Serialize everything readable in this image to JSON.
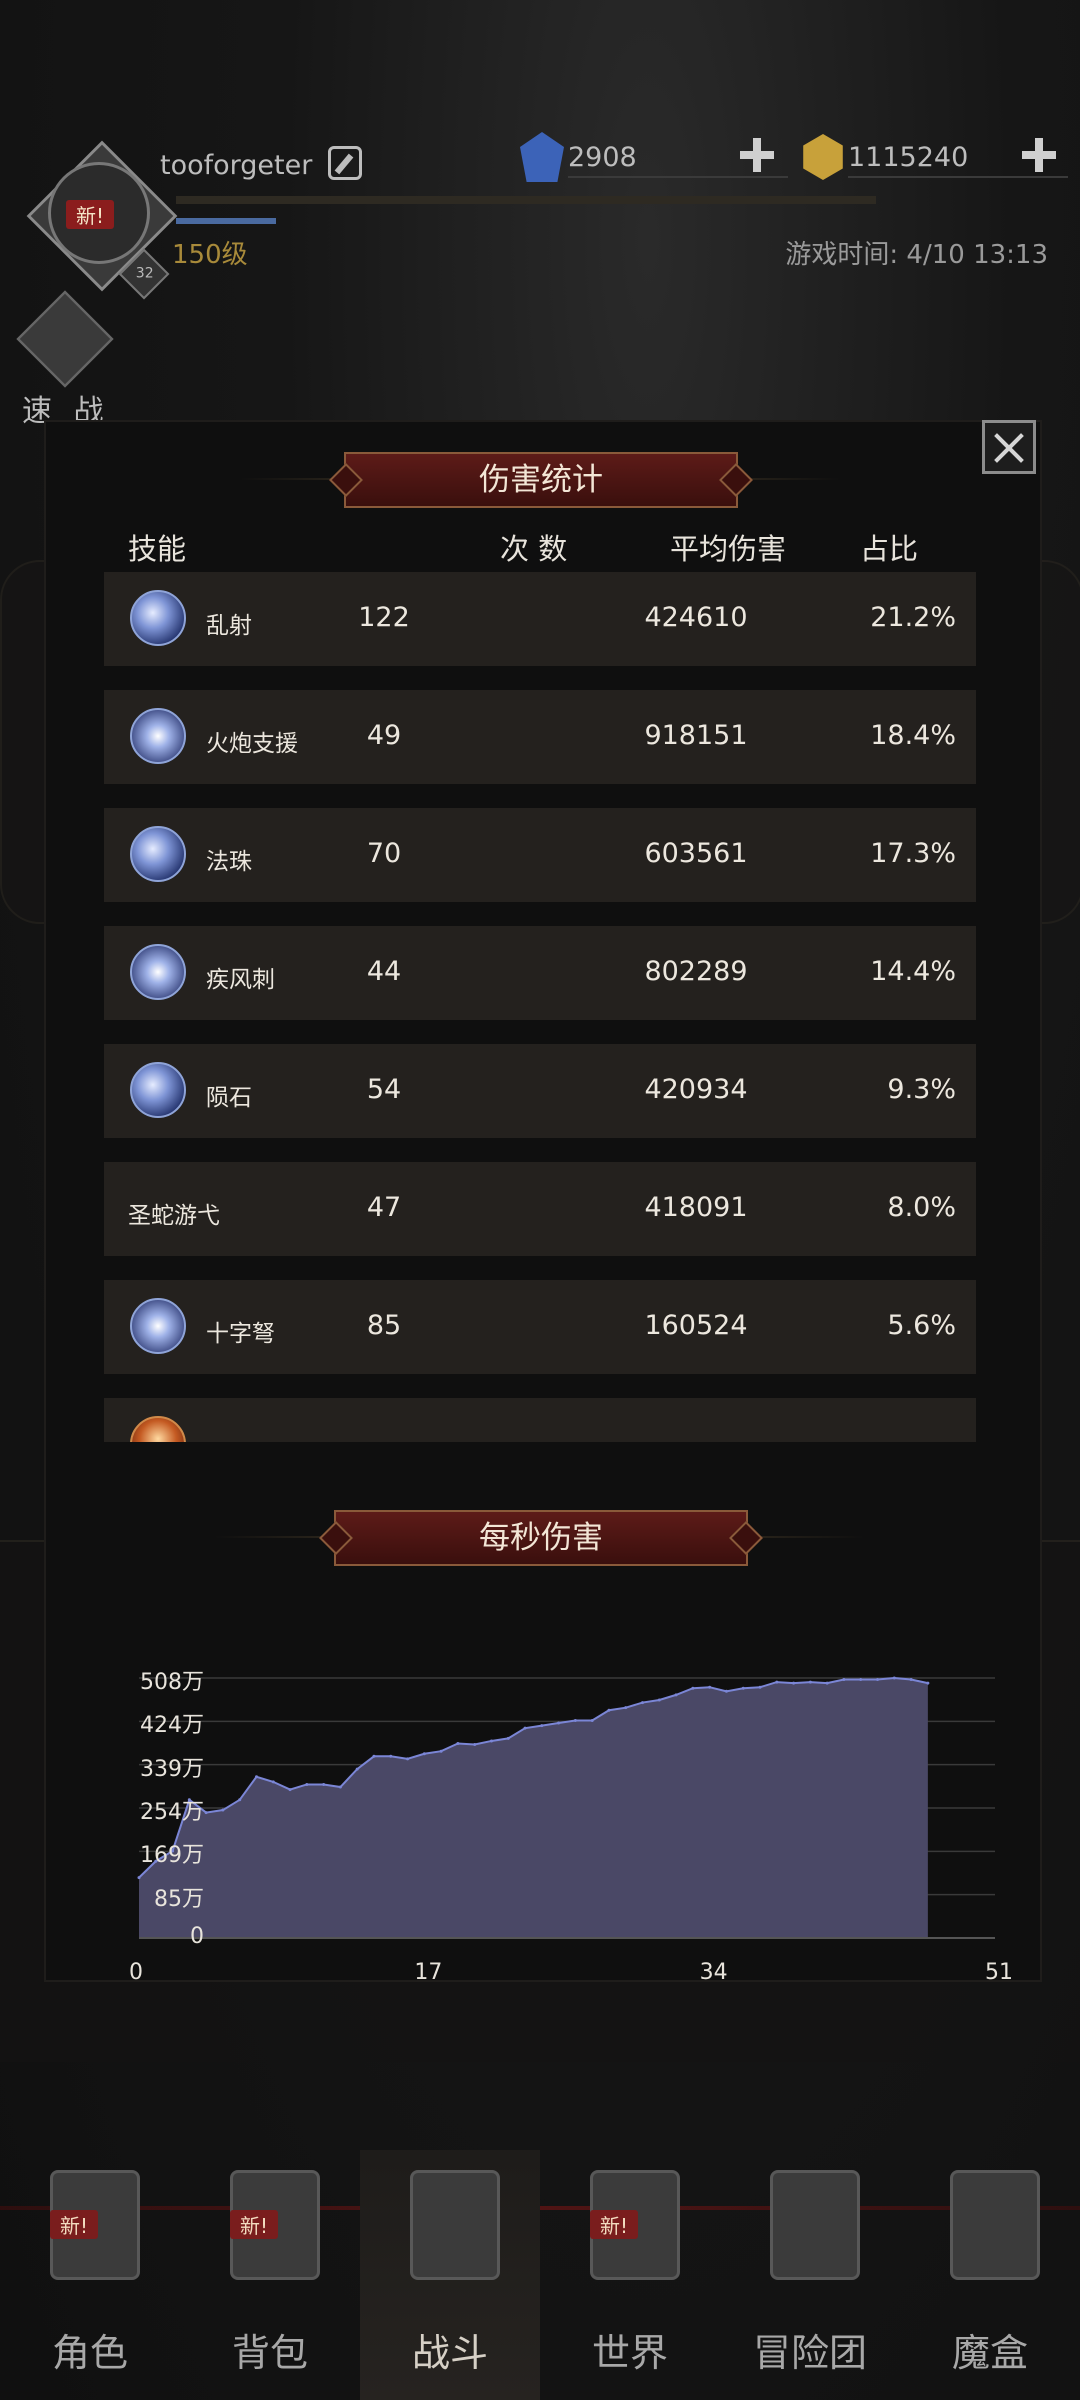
{
  "header": {
    "username": "tooforgeter",
    "level": "150级",
    "avatar_badge": "新!",
    "avatar_rank": "32",
    "currencies": [
      {
        "name": "gem",
        "value": "2908"
      },
      {
        "name": "gold",
        "value": "1115240"
      }
    ],
    "game_time": "游戏时间: 4/10 13:13",
    "quick_battle_label": "速 战"
  },
  "modal": {
    "title": "伤害统计",
    "columns": {
      "skill": "技能",
      "count": "次 数",
      "avg": "平均伤害",
      "share": "占比"
    },
    "rows": [
      {
        "name": "乱射",
        "count": "122",
        "avg": "424610",
        "share": "21.2%",
        "icon": "arrow-volley-icon"
      },
      {
        "name": "火炮支援",
        "count": "49",
        "avg": "918151",
        "share": "18.4%",
        "icon": "cannon-support-icon"
      },
      {
        "name": "法珠",
        "count": "70",
        "avg": "603561",
        "share": "17.3%",
        "icon": "magic-orb-icon"
      },
      {
        "name": "疾风刺",
        "count": "44",
        "avg": "802289",
        "share": "14.4%",
        "icon": "gale-thrust-icon"
      },
      {
        "name": "陨石",
        "count": "54",
        "avg": "420934",
        "share": "9.3%",
        "icon": "meteor-icon"
      },
      {
        "name": "圣蛇游弋",
        "count": "47",
        "avg": "418091",
        "share": "8.0%",
        "icon": ""
      },
      {
        "name": "十字弩",
        "count": "85",
        "avg": "160524",
        "share": "5.6%",
        "icon": "crossbow-icon"
      },
      {
        "name": "",
        "count": "",
        "avg": "",
        "share": "",
        "icon": "fire-skill-icon"
      }
    ],
    "dps_title": "每秒伤害"
  },
  "chart_data": {
    "type": "area",
    "title": "每秒伤害",
    "xlabel": "",
    "ylabel": "",
    "x_ticks": [
      "0",
      "17",
      "34",
      "51"
    ],
    "y_ticks": [
      "0",
      "85万",
      "169万",
      "254万",
      "339万",
      "424万",
      "508万"
    ],
    "xlim": [
      0,
      51
    ],
    "ylim": [
      0,
      508
    ],
    "grid": true,
    "fill_color": "#4a4866",
    "line_color": "#7b86d6",
    "x": [
      0,
      1,
      2,
      3,
      4,
      5,
      6,
      7,
      8,
      9,
      10,
      11,
      12,
      13,
      14,
      15,
      16,
      17,
      18,
      19,
      20,
      21,
      22,
      23,
      24,
      25,
      26,
      27,
      28,
      29,
      30,
      31,
      32,
      33,
      34,
      35,
      36,
      37,
      38,
      39,
      40,
      41,
      42,
      43,
      44,
      45,
      46,
      47
    ],
    "values": [
      118,
      150,
      170,
      270,
      245,
      250,
      270,
      315,
      305,
      290,
      300,
      300,
      295,
      330,
      355,
      355,
      350,
      360,
      365,
      380,
      378,
      385,
      390,
      410,
      415,
      420,
      425,
      425,
      445,
      450,
      460,
      465,
      475,
      488,
      490,
      482,
      488,
      490,
      500,
      498,
      500,
      498,
      505,
      505,
      505,
      508,
      505,
      498
    ]
  },
  "nav": [
    {
      "label": "角色",
      "icon": "helmet-icon",
      "new": "新!"
    },
    {
      "label": "背包",
      "icon": "backpack-icon",
      "new": "新!"
    },
    {
      "label": "战斗",
      "icon": "sword-shield-icon",
      "new": ""
    },
    {
      "label": "世界",
      "icon": "scroll-icon",
      "new": "新!"
    },
    {
      "label": "冒险团",
      "icon": "castle-icon",
      "new": ""
    },
    {
      "label": "魔盒",
      "icon": "magic-box-icon",
      "new": ""
    }
  ]
}
